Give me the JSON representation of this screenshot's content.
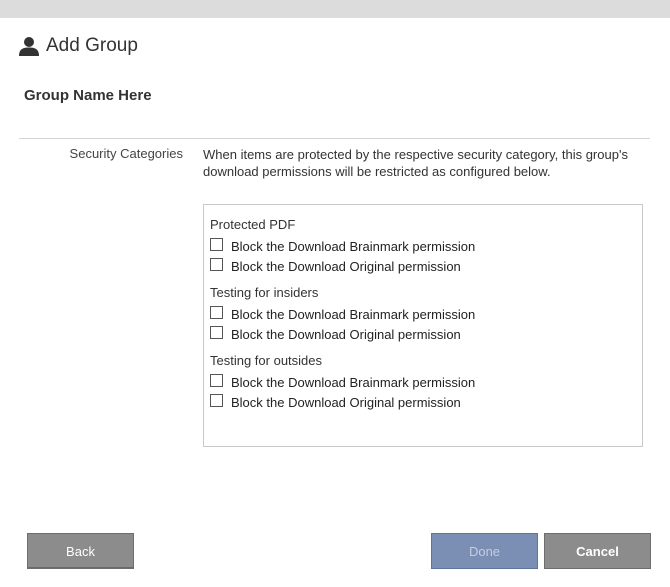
{
  "header": {
    "title": "Add Group",
    "icon": "user-icon"
  },
  "group_name": "Group Name Here",
  "security": {
    "label": "Security Categories",
    "description": "When items are protected by the respective security category, this group's download permissions will be restricted as configured below.",
    "categories": [
      {
        "title": "Protected PDF",
        "permissions": [
          {
            "label": "Block the Download Brainmark permission",
            "checked": false
          },
          {
            "label": "Block the Download Original permission",
            "checked": false
          }
        ]
      },
      {
        "title": "Testing for insiders",
        "permissions": [
          {
            "label": "Block the Download Brainmark permission",
            "checked": false
          },
          {
            "label": "Block the Download Original permission",
            "checked": false
          }
        ]
      },
      {
        "title": "Testing for outsides",
        "permissions": [
          {
            "label": "Block the Download Brainmark permission",
            "checked": false
          },
          {
            "label": "Block the Download Original permission",
            "checked": false
          }
        ]
      }
    ]
  },
  "buttons": {
    "back": "Back",
    "done": "Done",
    "cancel": "Cancel"
  },
  "colors": {
    "topbar": "#dcdcdc",
    "button_gray": "#8c8c8c",
    "button_primary_disabled": "#7b8fb5"
  }
}
